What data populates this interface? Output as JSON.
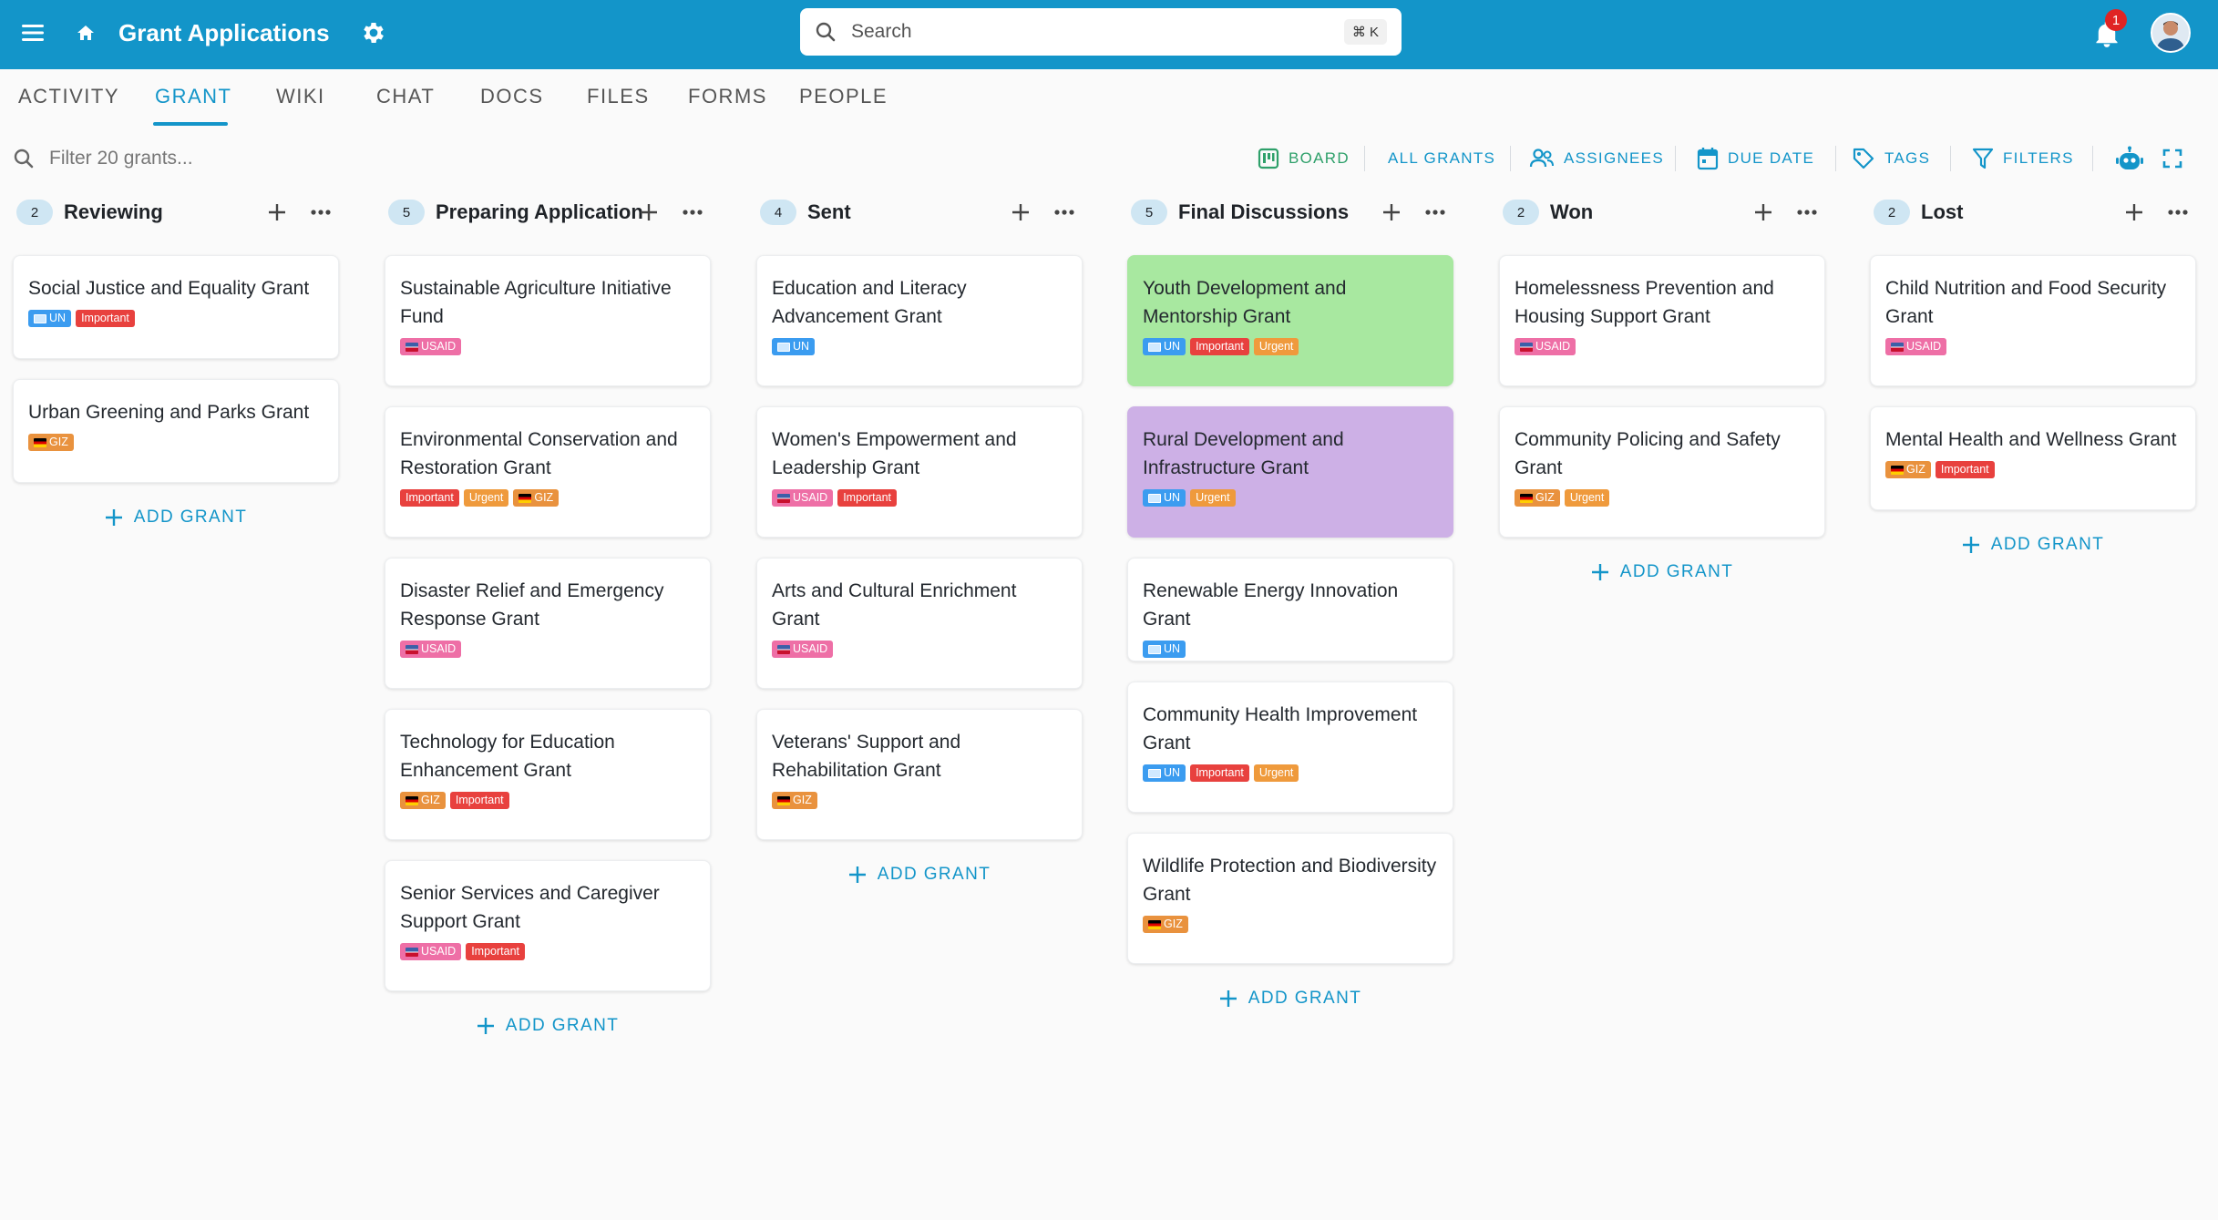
{
  "header": {
    "title": "Grant Applications",
    "search_placeholder": "Search",
    "search_shortcut": "⌘ K",
    "notification_count": "1",
    "bar_color": "#1395c9",
    "icons": [
      "menu-icon",
      "home-icon",
      "gear-icon",
      "search-icon",
      "bell-icon"
    ]
  },
  "tabs": [
    {
      "label": "ACTIVITY"
    },
    {
      "label": "GRANT",
      "active": true
    },
    {
      "label": "WIKI"
    },
    {
      "label": "CHAT"
    },
    {
      "label": "DOCS"
    },
    {
      "label": "FILES"
    },
    {
      "label": "FORMS"
    },
    {
      "label": "PEOPLE"
    }
  ],
  "toolbar": {
    "filter_placeholder": "Filter 20 grants...",
    "board_label": "BOARD",
    "all_grants_label": "ALL GRANTS",
    "assignees_label": "ASSIGNEES",
    "due_date_label": "DUE DATE",
    "tags_label": "TAGS",
    "filters_label": "FILTERS"
  },
  "tag_colors": {
    "UN": "#3b9cf0",
    "USAID": "#ee6fa6",
    "GIZ": "#e9923e",
    "Important": "#e8413e",
    "Urgent": "#ef9a3c"
  },
  "add_grant_label": "ADD GRANT",
  "columns": [
    {
      "title": "Reviewing",
      "count": "2",
      "cards": [
        {
          "title": "Social Justice and Equality Grant",
          "tags": [
            "UN",
            "Important"
          ]
        },
        {
          "title": "Urban Greening and Parks Grant",
          "tags": [
            "GIZ"
          ]
        }
      ]
    },
    {
      "title": "Preparing Application",
      "count": "5",
      "cards": [
        {
          "title": "Sustainable Agriculture Initiative Fund",
          "tags": [
            "USAID"
          ]
        },
        {
          "title": "Environmental Conservation and Restoration Grant",
          "tags": [
            "Important",
            "Urgent",
            "GIZ"
          ]
        },
        {
          "title": "Disaster Relief and Emergency Response Grant",
          "tags": [
            "USAID"
          ]
        },
        {
          "title": "Technology for Education Enhancement Grant",
          "tags": [
            "GIZ",
            "Important"
          ]
        },
        {
          "title": "Senior Services and Caregiver Support Grant",
          "tags": [
            "USAID",
            "Important"
          ]
        }
      ]
    },
    {
      "title": "Sent",
      "count": "4",
      "cards": [
        {
          "title": "Education and Literacy Advancement Grant",
          "tags": [
            "UN"
          ]
        },
        {
          "title": "Women's Empowerment and Leadership Grant",
          "tags": [
            "USAID",
            "Important"
          ]
        },
        {
          "title": "Arts and Cultural Enrichment Grant",
          "tags": [
            "USAID"
          ]
        },
        {
          "title": "Veterans' Support and Rehabilitation Grant",
          "tags": [
            "GIZ"
          ]
        }
      ]
    },
    {
      "title": "Final Discussions",
      "count": "5",
      "cards": [
        {
          "title": "Youth Development and Mentorship Grant",
          "tags": [
            "UN",
            "Important",
            "Urgent"
          ],
          "color": "#a8e8a0"
        },
        {
          "title": "Rural Development and Infrastructure Grant",
          "tags": [
            "UN",
            "Urgent"
          ],
          "color": "#cdb0e6"
        },
        {
          "title": "Renewable Energy Innovation Grant",
          "tags": [
            "UN"
          ]
        },
        {
          "title": "Community Health Improvement Grant",
          "tags": [
            "UN",
            "Important",
            "Urgent"
          ]
        },
        {
          "title": "Wildlife Protection and Biodiversity Grant",
          "tags": [
            "GIZ"
          ]
        }
      ]
    },
    {
      "title": "Won",
      "count": "2",
      "cards": [
        {
          "title": "Homelessness Prevention and Housing Support Grant",
          "tags": [
            "USAID"
          ]
        },
        {
          "title": "Community Policing and Safety Grant",
          "tags": [
            "GIZ",
            "Urgent"
          ]
        }
      ]
    },
    {
      "title": "Lost",
      "count": "2",
      "cards": [
        {
          "title": "Child Nutrition and Food Security Grant",
          "tags": [
            "USAID"
          ]
        },
        {
          "title": "Mental Health and Wellness Grant",
          "tags": [
            "GIZ",
            "Important"
          ]
        }
      ]
    }
  ]
}
